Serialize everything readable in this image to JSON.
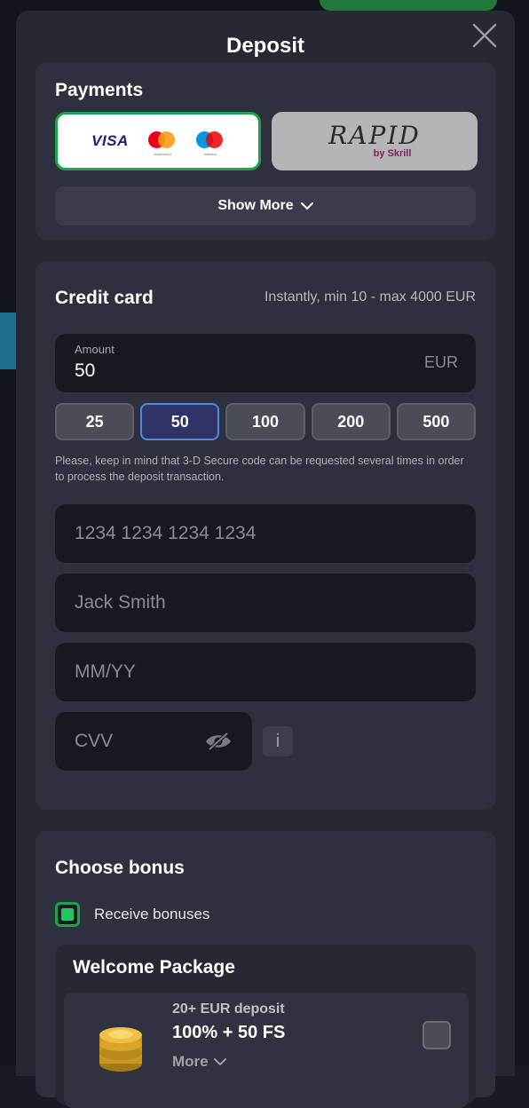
{
  "modal": {
    "title": "Deposit"
  },
  "payments": {
    "heading": "Payments",
    "methods": [
      {
        "id": "cards",
        "visa": "VISA",
        "mastercard_sub": "mastercard",
        "maestro_sub": "maestro",
        "selected": true
      },
      {
        "id": "rapid",
        "name": "RAPID",
        "by": "by Skrill",
        "selected": false
      }
    ],
    "show_more": "Show More"
  },
  "credit_card": {
    "heading": "Credit card",
    "limits": "Instantly,  min 10 - max 4000 EUR",
    "amount": {
      "label": "Amount",
      "value": "50",
      "currency": "EUR"
    },
    "presets": [
      "25",
      "50",
      "100",
      "200",
      "500"
    ],
    "active_preset": "50",
    "note": "Please, keep in mind that 3-D Secure code can be requested several times in order to process the deposit transaction.",
    "fields": {
      "card_number_placeholder": "1234 1234 1234 1234",
      "name_placeholder": "Jack Smith",
      "expiry_placeholder": "MM/YY",
      "cvv_placeholder": "CVV"
    },
    "info_icon": "i"
  },
  "bonus": {
    "heading": "Choose bonus",
    "receive_label": "Receive bonuses",
    "receive_checked": true,
    "package": {
      "title": "Welcome Package",
      "offer": {
        "deposit": "20+ EUR deposit",
        "headline": "100% + 50 FS",
        "more": "More"
      }
    }
  },
  "colors": {
    "accent_green": "#1fa34a",
    "active_chip_border": "#4a8ae8",
    "panel": "#2e303d"
  }
}
